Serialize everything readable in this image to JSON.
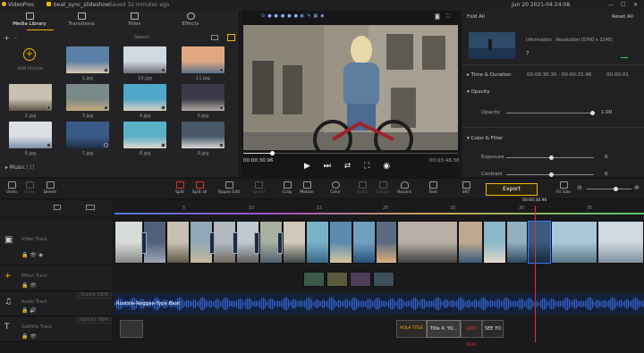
{
  "titlebar": {
    "app_name": "VideoProc",
    "project": "beat_sync_slideshow",
    "saved": "Saved 32 minutes ago",
    "datetime": "Jun 20 2021-04:24:08"
  },
  "tabs": [
    {
      "label": "Media Library"
    },
    {
      "label": "Transitions"
    },
    {
      "label": "Titles"
    },
    {
      "label": "Effects"
    }
  ],
  "search": {
    "placeholder": "Search..."
  },
  "add_picture": "Add Picture",
  "media": [
    {
      "name": "1.jpg"
    },
    {
      "name": "10.jpg"
    },
    {
      "name": "11.jpg"
    },
    {
      "name": "2.jpg"
    },
    {
      "name": "3.jpg"
    },
    {
      "name": "4.jpg"
    },
    {
      "name": "5.jpg"
    },
    {
      "name": "6.jpg"
    },
    {
      "name": "7.jpg"
    },
    {
      "name": "8.jpg"
    },
    {
      "name": "9.jpg"
    }
  ],
  "music_section": {
    "label": "Music",
    "count": "[1]"
  },
  "preview": {
    "current_time": "00:00:30.96",
    "total_time": "00:03:48.38"
  },
  "right": {
    "fold_all": "Fold All",
    "reset_all": "Reset All",
    "info": "Information : Resolution (5760 x 3240)",
    "info_value": "7",
    "time_duration": "Time & Duration",
    "time_range": "00:00:30.30 - 00:00:31.96",
    "duration": "00:00:01",
    "opacity_section": "Opacity",
    "opacity_label": "Opacity",
    "opacity_value": "1.00",
    "color_section": "Color & Filter",
    "exposure_label": "Exposure",
    "exposure_value": "0",
    "contrast_label": "Contrast",
    "contrast_value": "0"
  },
  "toolbar": {
    "undo": "Undo",
    "redo": "Redo",
    "delete": "Delete",
    "split": "Split",
    "split_all": "Split all",
    "ripple_edit": "Ripple Edit",
    "speed": "Speed",
    "crop": "Crop",
    "motion": "Motion",
    "color": "Color",
    "audio": "Audio",
    "detach": "Detach",
    "record": "Record",
    "text": "Text",
    "export_item": "SRT",
    "export": "Export",
    "fit_size": "Fit Size"
  },
  "ruler": {
    "marks": [
      "5",
      "10",
      "15",
      "20",
      "25",
      "30",
      "35"
    ],
    "playhead": "00:00:30.96"
  },
  "tracks": {
    "video": "Video Track",
    "effect": "Effect Track",
    "audio": "Audio Track",
    "subtitle": "Subtitle Track",
    "volume_label": "Volume 100%",
    "opacity_label": "Opacity 100%"
  },
  "audio_clip": "Rootsie-Reggae-Type Beat",
  "subtitle_clips": [
    "HOLA TITLE",
    "Title 4: YO...",
    "HAPPY NEWS",
    "SEE YO"
  ],
  "colors": {
    "accent": "#f2b600",
    "playhead": "#e03030",
    "audio_wave": "#2e62c8",
    "selection": "#3c78ff"
  }
}
